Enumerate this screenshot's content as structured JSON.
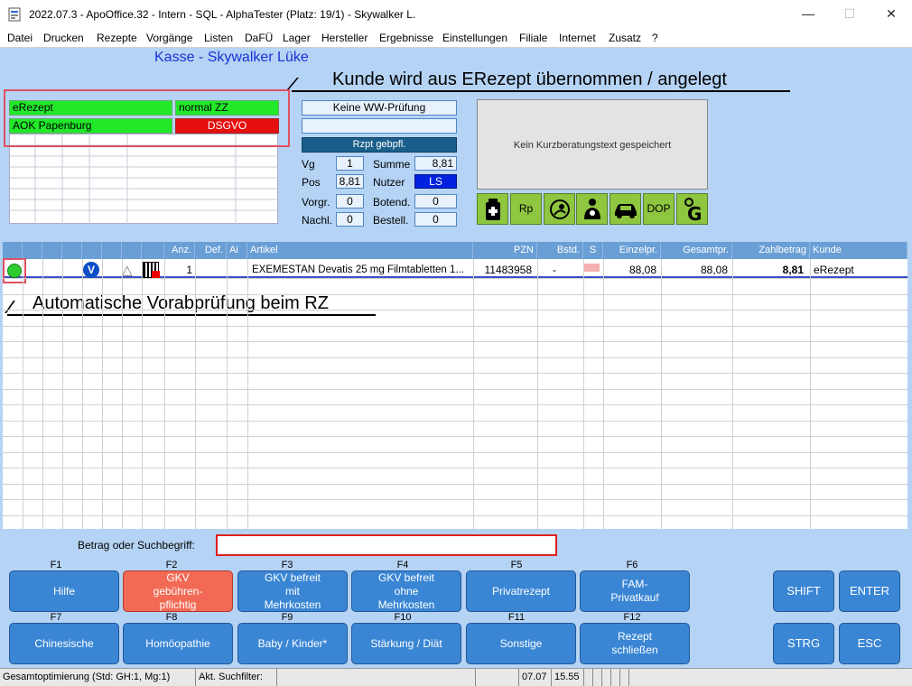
{
  "window": {
    "title": "2022.07.3 - ApoOffice.32 - Intern - SQL - AlphaTester (Platz: 19/1) - Skywalker L.",
    "min": "—",
    "max": "☐",
    "close": "✕"
  },
  "menu": [
    "Datei",
    "Drucken",
    "Rezepte",
    "Vorgänge",
    "Listen",
    "DaFÜ",
    "Lager",
    "Hersteller",
    "Ergebnisse",
    "Einstellungen",
    "Filiale",
    "Internet",
    "Zusatz",
    "?"
  ],
  "header": {
    "kasse_title": "Kasse - Skywalker Lüke",
    "annotation_customer": "Kunde wird aus ERezept übernommen / angelegt",
    "annotation_check": "Automatische Vorabprüfung beim RZ"
  },
  "customer": {
    "type": "eRezept",
    "zz": "normal ZZ",
    "insurance": "AOK Papenburg",
    "privacy": "DSGVO"
  },
  "info": {
    "ww_check": "Keine WW-Prüfung",
    "empty_box": "",
    "rx_status": "Rzpt gebpfl.",
    "vg_label": "Vg",
    "vg_value": "1",
    "summe_label": "Summe",
    "summe_value": "8,81",
    "pos_label": "Pos",
    "pos_value": "8,81",
    "nutzer_label": "Nutzer",
    "nutzer_value": "LS",
    "vorgr_label": "Vorgr.",
    "vorgr_value": "0",
    "botend_label": "Botend.",
    "botend_value": "0",
    "nachl_label": "Nachl.",
    "nachl_value": "0",
    "bestell_label": "Bestell.",
    "bestell_value": "0"
  },
  "kurzberatung": "Kein Kurzberatungstext gespeichert",
  "quick_icons": [
    "+",
    "Rp",
    "◔",
    "♿",
    "🚗",
    "DOP",
    "G"
  ],
  "table": {
    "headers": [
      "Anz.",
      "Def.",
      "Ai",
      "Artikel",
      "PZN",
      "Bstd.",
      "S",
      "Einzelpr.",
      "Gesamtpr.",
      "Zahlbetrag",
      "Kunde"
    ],
    "rows": [
      {
        "anz": "1",
        "def": "",
        "ai": "",
        "artikel": "EXEMESTAN Devatis 25 mg Filmtabletten 1...",
        "pzn": "11483958",
        "bstd": "-",
        "einzelpr": "88,08",
        "gesamtpr": "88,08",
        "zahlbetrag": "8,81",
        "kunde": "eRezept",
        "v_badge": "V",
        "warn_icon": "△"
      }
    ]
  },
  "search": {
    "label": "Betrag oder Suchbegriff:",
    "value": ""
  },
  "fkeys_row1": [
    {
      "key": "F1",
      "label": "Hilfe"
    },
    {
      "key": "F2",
      "label": "GKV gebühren-pflichtig"
    },
    {
      "key": "F3",
      "label": "GKV befreit mit Mehrkosten"
    },
    {
      "key": "F4",
      "label": "GKV befreit ohne Mehrkosten"
    },
    {
      "key": "F5",
      "label": "Privatrezept"
    },
    {
      "key": "F6",
      "label": "FAM-Privatkauf"
    }
  ],
  "fkeys_row2": [
    {
      "key": "F7",
      "label": "Chinesische"
    },
    {
      "key": "F8",
      "label": "Homöopathie"
    },
    {
      "key": "F9",
      "label": "Baby / Kinder*"
    },
    {
      "key": "F10",
      "label": "Stärkung / Diät"
    },
    {
      "key": "F11",
      "label": "Sonstige"
    },
    {
      "key": "F12",
      "label": "Rezept schließen"
    }
  ],
  "side_keys": [
    "SHIFT",
    "ENTER",
    "STRG",
    "ESC"
  ],
  "statusbar": {
    "optimization": "Gesamtoptimierung (Std: GH:1, Mg:1)",
    "filter": "Akt. Suchfilter:",
    "date": "07.07",
    "time": "15.55"
  },
  "colors": {
    "background": "#b5d3f4",
    "button": "#3a86d4",
    "button_active": "#f26a55",
    "green": "#22e82a",
    "red": "#e60f0f"
  }
}
